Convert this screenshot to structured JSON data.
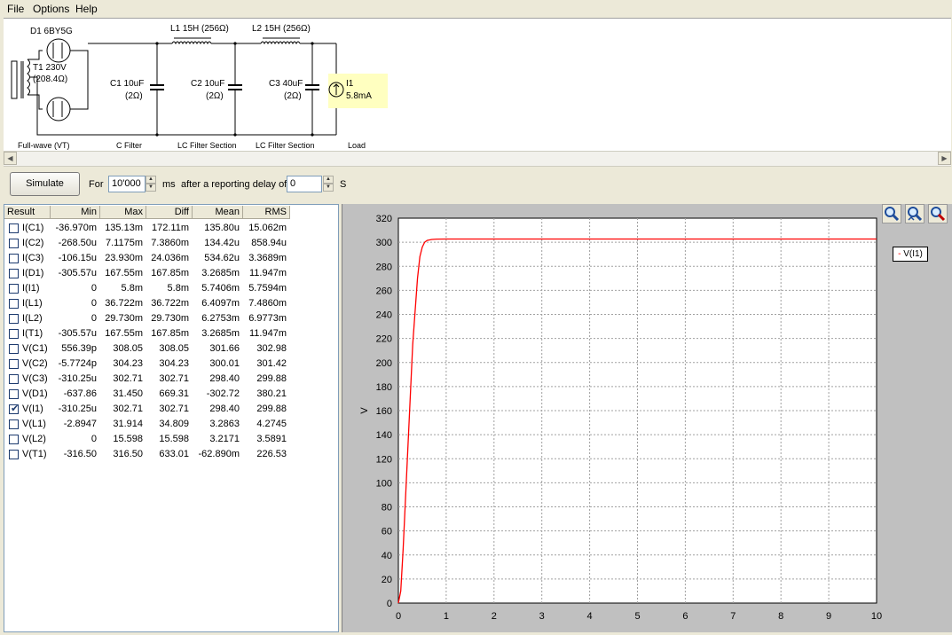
{
  "menu": {
    "items": [
      "File",
      "Options",
      "Help"
    ]
  },
  "schematic": {
    "d1_label": "D1 6BY5G",
    "t1_label": "T1 230V",
    "t1_res": "(208.4Ω)",
    "l1_label": "L1 15H (256Ω)",
    "l2_label": "L2 15H (256Ω)",
    "c1_label": "C1 10uF",
    "c1_res": "(2Ω)",
    "c2_label": "C2 10uF",
    "c2_res": "(2Ω)",
    "c3_label": "C3 40uF",
    "c3_res": "(2Ω)",
    "i1_label": "I1",
    "i1_value": "5.8mA",
    "section_labels": [
      "Full-wave (VT)",
      "C Filter",
      "LC Filter Section",
      "LC Filter Section",
      "Load"
    ]
  },
  "toolbar": {
    "simulate_label": "Simulate",
    "for_label": "For",
    "duration_value": "10'000",
    "ms_label": "ms",
    "delay_label": "after a reporting delay of",
    "delay_value": "0",
    "s_label": "S"
  },
  "results": {
    "columns": [
      "Result",
      "Min",
      "Max",
      "Diff",
      "Mean",
      "RMS"
    ],
    "rows": [
      {
        "name": "I(C1)",
        "checked": false,
        "min": "-36.970m",
        "max": "135.13m",
        "diff": "172.11m",
        "mean": "135.80u",
        "rms": "15.062m"
      },
      {
        "name": "I(C2)",
        "checked": false,
        "min": "-268.50u",
        "max": "7.1175m",
        "diff": "7.3860m",
        "mean": "134.42u",
        "rms": "858.94u"
      },
      {
        "name": "I(C3)",
        "checked": false,
        "min": "-106.15u",
        "max": "23.930m",
        "diff": "24.036m",
        "mean": "534.62u",
        "rms": "3.3689m"
      },
      {
        "name": "I(D1)",
        "checked": false,
        "min": "-305.57u",
        "max": "167.55m",
        "diff": "167.85m",
        "mean": "3.2685m",
        "rms": "11.947m"
      },
      {
        "name": "I(I1)",
        "checked": false,
        "min": "0",
        "max": "5.8m",
        "diff": "5.8m",
        "mean": "5.7406m",
        "rms": "5.7594m"
      },
      {
        "name": "I(L1)",
        "checked": false,
        "min": "0",
        "max": "36.722m",
        "diff": "36.722m",
        "mean": "6.4097m",
        "rms": "7.4860m"
      },
      {
        "name": "I(L2)",
        "checked": false,
        "min": "0",
        "max": "29.730m",
        "diff": "29.730m",
        "mean": "6.2753m",
        "rms": "6.9773m"
      },
      {
        "name": "I(T1)",
        "checked": false,
        "min": "-305.57u",
        "max": "167.55m",
        "diff": "167.85m",
        "mean": "3.2685m",
        "rms": "11.947m"
      },
      {
        "name": "V(C1)",
        "checked": false,
        "min": "556.39p",
        "max": "308.05",
        "diff": "308.05",
        "mean": "301.66",
        "rms": "302.98"
      },
      {
        "name": "V(C2)",
        "checked": false,
        "min": "-5.7724p",
        "max": "304.23",
        "diff": "304.23",
        "mean": "300.01",
        "rms": "301.42"
      },
      {
        "name": "V(C3)",
        "checked": false,
        "min": "-310.25u",
        "max": "302.71",
        "diff": "302.71",
        "mean": "298.40",
        "rms": "299.88"
      },
      {
        "name": "V(D1)",
        "checked": false,
        "min": "-637.86",
        "max": "31.450",
        "diff": "669.31",
        "mean": "-302.72",
        "rms": "380.21"
      },
      {
        "name": "V(I1)",
        "checked": true,
        "min": "-310.25u",
        "max": "302.71",
        "diff": "302.71",
        "mean": "298.40",
        "rms": "299.88"
      },
      {
        "name": "V(L1)",
        "checked": false,
        "min": "-2.8947",
        "max": "31.914",
        "diff": "34.809",
        "mean": "3.2863",
        "rms": "4.2745"
      },
      {
        "name": "V(L2)",
        "checked": false,
        "min": "0",
        "max": "15.598",
        "diff": "15.598",
        "mean": "3.2171",
        "rms": "3.5891"
      },
      {
        "name": "V(T1)",
        "checked": false,
        "min": "-316.50",
        "max": "316.50",
        "diff": "633.01",
        "mean": "-62.890m",
        "rms": "226.53"
      }
    ]
  },
  "chart_data": {
    "type": "line",
    "ylabel": "V",
    "xlim": [
      0,
      10
    ],
    "ylim": [
      0,
      320
    ],
    "xticks": [
      0,
      1,
      2,
      3,
      4,
      5,
      6,
      7,
      8,
      9,
      10
    ],
    "yticks": [
      0,
      20,
      40,
      60,
      80,
      100,
      120,
      140,
      160,
      180,
      200,
      220,
      240,
      260,
      280,
      300,
      320
    ],
    "grid": true,
    "legend_position": "top-right",
    "series": [
      {
        "name": "V(I1)",
        "color": "#ff0000",
        "x": [
          0,
          0.05,
          0.1,
          0.2,
          0.3,
          0.4,
          0.45,
          0.5,
          0.55,
          0.6,
          0.7,
          0.8,
          1.0,
          1.5,
          2,
          3,
          4,
          5,
          6,
          7,
          8,
          9,
          10
        ],
        "y": [
          0,
          10,
          45,
          130,
          215,
          270,
          288,
          296,
          300,
          301.5,
          302.3,
          302.6,
          302.7,
          302.7,
          302.7,
          302.7,
          302.7,
          302.7,
          302.7,
          302.7,
          302.7,
          302.7,
          302.7
        ]
      }
    ]
  },
  "zoom": {
    "icons": [
      "zoom-in-icon",
      "zoom-out-icon",
      "zoom-reset-icon"
    ]
  },
  "colors": {
    "schematic_label_bg": "#ffffc0",
    "trace": "#ff0000",
    "chart_bg": "#c0c0c0",
    "plot_bg": "#ffffff"
  }
}
